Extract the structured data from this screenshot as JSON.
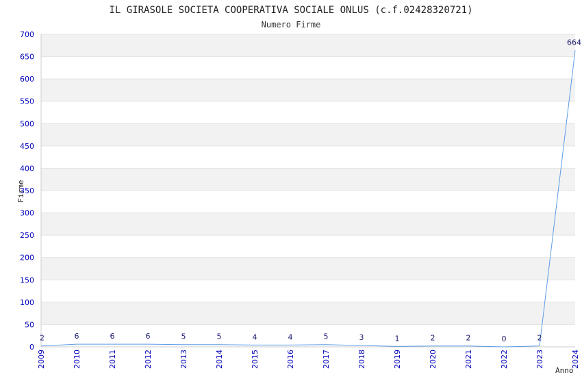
{
  "chart_data": {
    "type": "line",
    "title": "IL GIRASOLE SOCIETA COOPERATIVA SOCIALE ONLUS (c.f.02428320721)",
    "subtitle": "Numero Firme",
    "xlabel": "Anno",
    "ylabel": "Firme",
    "x": [
      "2009",
      "2010",
      "2011",
      "2012",
      "2013",
      "2014",
      "2015",
      "2016",
      "2017",
      "2018",
      "2019",
      "2020",
      "2021",
      "2022",
      "2023",
      "2024"
    ],
    "values": [
      2,
      6,
      6,
      6,
      5,
      5,
      4,
      4,
      5,
      3,
      1,
      2,
      2,
      0,
      2,
      664
    ],
    "ylim": [
      0,
      700
    ],
    "yticks": [
      0,
      50,
      100,
      150,
      200,
      250,
      300,
      350,
      400,
      450,
      500,
      550,
      600,
      650,
      700
    ],
    "grid": true,
    "line_color": "#5a9be6",
    "band_color": "#f2f2f2",
    "tick_color": "#0000bb"
  }
}
